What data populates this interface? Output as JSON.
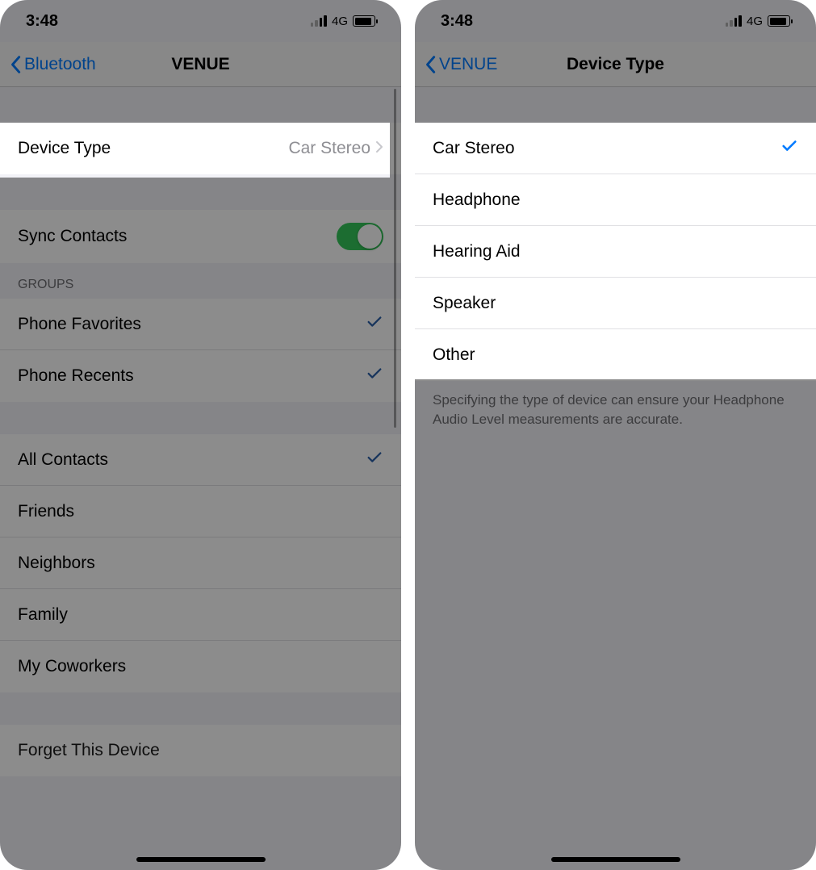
{
  "status": {
    "time": "3:48",
    "network": "4G"
  },
  "left": {
    "nav": {
      "back": "Bluetooth",
      "title": "VENUE"
    },
    "device_type": {
      "label": "Device Type",
      "value": "Car Stereo"
    },
    "sync": {
      "label": "Sync Contacts",
      "on": true
    },
    "groups_header": "GROUPS",
    "groups1": [
      {
        "label": "Phone Favorites",
        "checked": true
      },
      {
        "label": "Phone Recents",
        "checked": true
      }
    ],
    "groups2": [
      {
        "label": "All Contacts",
        "checked": true
      },
      {
        "label": "Friends",
        "checked": false
      },
      {
        "label": "Neighbors",
        "checked": false
      },
      {
        "label": "Family",
        "checked": false
      },
      {
        "label": "My Coworkers",
        "checked": false
      }
    ],
    "forget": "Forget This Device"
  },
  "right": {
    "nav": {
      "back": "VENUE",
      "title": "Device Type"
    },
    "options": [
      {
        "label": "Car Stereo",
        "checked": true
      },
      {
        "label": "Headphone",
        "checked": false
      },
      {
        "label": "Hearing Aid",
        "checked": false
      },
      {
        "label": "Speaker",
        "checked": false
      },
      {
        "label": "Other",
        "checked": false
      }
    ],
    "footer": "Specifying the type of device can ensure your Headphone Audio Level measurements are accurate."
  }
}
